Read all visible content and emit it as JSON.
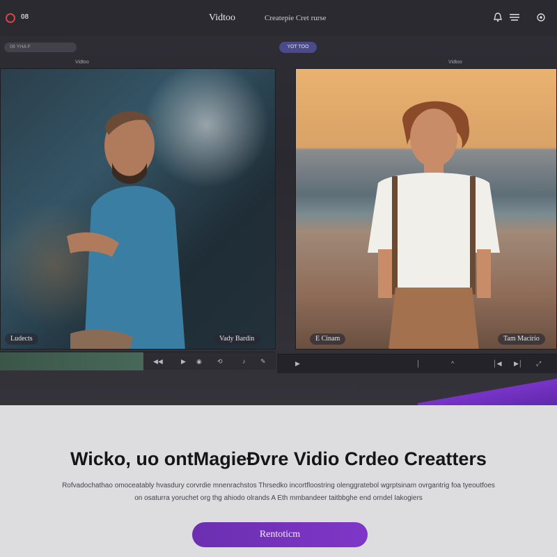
{
  "topbar": {
    "logo_text": "08",
    "title": "Vidtoo",
    "subtitle": "Createpie Cret rurse"
  },
  "toolbar": {
    "search_text": "08 YHA F",
    "status_pill": "YOT TOO",
    "left_strip_label": "Vidtoo",
    "right_strip_label": "Vidtoo"
  },
  "panels": {
    "left_caption": "Ludects",
    "left_caption_2": "Vady Bardin",
    "right_caption": "E Cinam",
    "right_caption_2": "Tam Macirio"
  },
  "timeline": {
    "progress": 0.52
  },
  "hero": {
    "headline": "Wicko, uo ontMagieĐvre Vidio Crdeo Creatters",
    "body_line_1": "Rofvadochathao omoceatably hvasdury corvrdie mnenrachstos Thrsedko incortfloostring olenggratebol wgrptsinam ovrgantrig foa tyeoutfoes",
    "body_line_2": "on osaturra yoruchet org thg ahiodo olrands A Eth mmbandeer taitbbghe end orndel Iakogiers",
    "cta_label": "Rentoticm"
  },
  "colors": {
    "accent": "#7a33c9",
    "app_bg": "#2b2a30",
    "hero_bg": "#dddde0"
  }
}
